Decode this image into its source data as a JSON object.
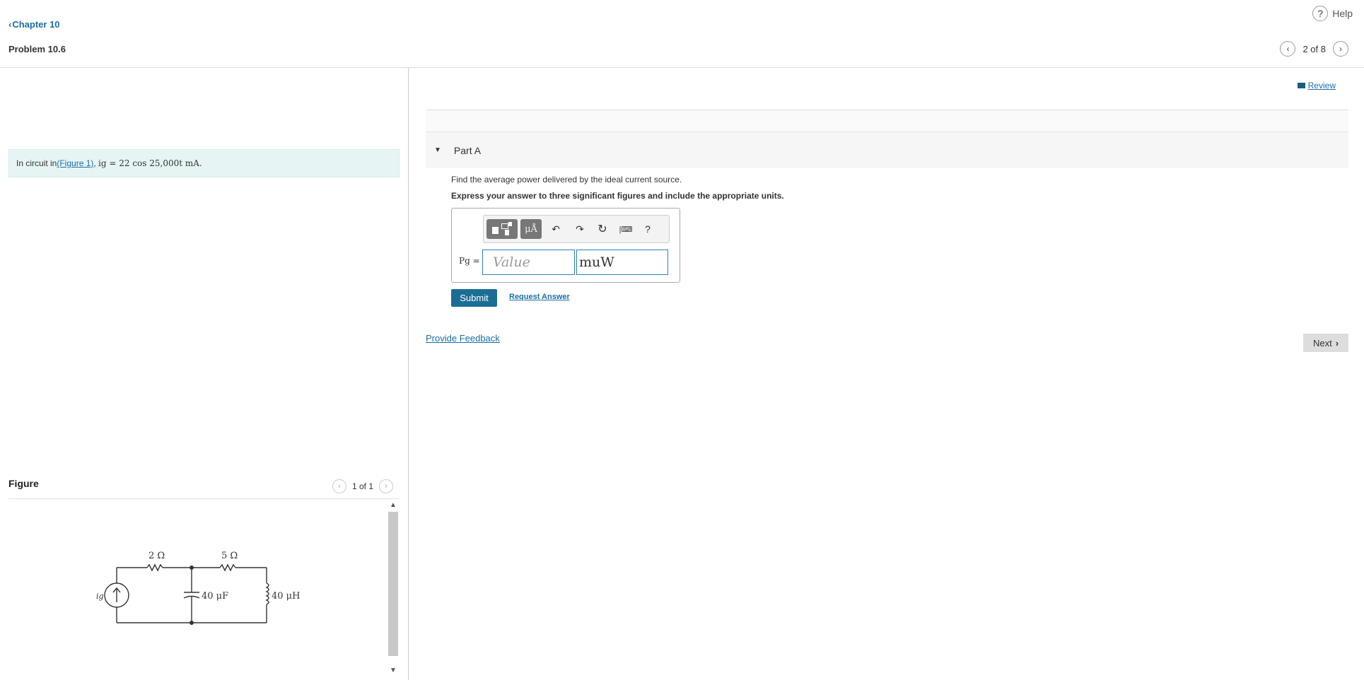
{
  "header": {
    "chapter_link": "Chapter 10",
    "problem_title": "Problem 10.6",
    "help_label": "Help",
    "pager_text": "2 of 8"
  },
  "problem": {
    "prefix": "In circuit in ",
    "figure_link": "(Figure 1)",
    "separator": ", ",
    "equation": "ig = 22 cos 25,000t mA."
  },
  "figure": {
    "label": "Figure",
    "pager_text": "1 of 1",
    "components": {
      "source_label": "ig",
      "resistor1": "2 Ω",
      "resistor2": "5 Ω",
      "capacitor": "40 μF",
      "inductor": "40 μH"
    }
  },
  "review_link": "Review",
  "part": {
    "title": "Part A",
    "question": "Find the average power delivered by the ideal current source.",
    "instruction": "Express your answer to three significant figures and include the appropriate units.",
    "answer_label": "Pg =",
    "value_placeholder": "Value",
    "units_value": "muW",
    "toolbar": {
      "units_button": "μÅ",
      "undo_icon": "↶",
      "redo_icon": "↷",
      "reset_icon": "↻",
      "keyboard_icon": "|⌨",
      "help_icon": "?"
    },
    "submit_label": "Submit",
    "request_answer_label": "Request Answer"
  },
  "footer": {
    "feedback_link": "Provide Feedback",
    "next_label": "Next"
  }
}
